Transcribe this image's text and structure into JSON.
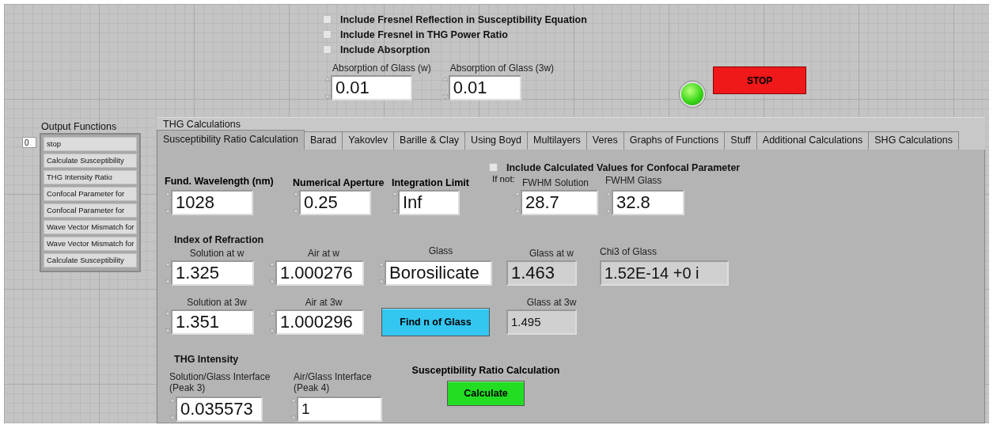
{
  "top_options": [
    {
      "label": "Include Fresnel Reflection in Susceptibility Equation",
      "checked": false
    },
    {
      "label": "Include Fresnel in THG Power Ratio",
      "checked": false
    },
    {
      "label": "Include Absorption",
      "checked": false
    }
  ],
  "absorption": [
    {
      "label": "Absorption of Glass (w)",
      "value": "0.01"
    },
    {
      "label": "Absorption of Glass (3w)",
      "value": "0.01"
    }
  ],
  "indicator_light": {
    "on": true
  },
  "stop_button": {
    "label": "STOP"
  },
  "output_functions": {
    "title": "Output Functions",
    "index": "0",
    "items": [
      "stop",
      "Calculate Susceptibility",
      "THG Intensity Ratio",
      "Confocal Parameter for",
      "Confocal Parameter for",
      "Wave Vector Mismatch for",
      "Wave Vector Mismatch for",
      "Calculate Susceptibility"
    ]
  },
  "tab_control": {
    "label": "THG Calculations",
    "tabs": [
      {
        "label": "Susceptibility Ratio Calculation",
        "selected": true
      },
      {
        "label": "Barad",
        "selected": false
      },
      {
        "label": "Yakovlev",
        "selected": false
      },
      {
        "label": "Barille & Clay",
        "selected": false
      },
      {
        "label": "Using Boyd",
        "selected": false
      },
      {
        "label": "Multilayers",
        "selected": false
      },
      {
        "label": "Veres",
        "selected": false
      },
      {
        "label": "Graphs of Functions",
        "selected": false
      },
      {
        "label": "Stuff",
        "selected": false
      },
      {
        "label": "Additional Calculations",
        "selected": false
      },
      {
        "label": "SHG Calculations",
        "selected": false
      }
    ],
    "confocal_option": {
      "label": "Include Calculated Values for Confocal Parameter",
      "checked": false,
      "note": "If not:"
    },
    "sections": [
      {
        "rows": [
          [
            {
              "kind": "numeric",
              "label": "Fund. Wavelength (nm)",
              "bold_label": true,
              "value": "1028"
            },
            {
              "kind": "numeric",
              "label": "Numerical Aperture",
              "bold_label": true,
              "value": "0.25"
            },
            {
              "kind": "numeric",
              "label": "Integration Limit",
              "bold_label": true,
              "value": "Inf"
            },
            {
              "kind": "numeric",
              "label": "FWHM Solution",
              "bold_label": false,
              "value": "28.7"
            },
            {
              "kind": "numeric",
              "label": "FWHM Glass",
              "bold_label": false,
              "value": "32.8"
            }
          ]
        ]
      },
      {
        "heading": "Index of Refraction",
        "rows": [
          [
            {
              "kind": "numeric",
              "label": "Solution at w",
              "bold_label": false,
              "value": "1.325"
            },
            {
              "kind": "numeric",
              "label": "Air at w",
              "bold_label": false,
              "value": "1.000276"
            },
            {
              "kind": "numeric",
              "label": "Glass",
              "bold_label": false,
              "value": "Borosilicate"
            },
            {
              "kind": "indicator",
              "label": "Glass at w",
              "bold_label": false,
              "value": "1.463"
            },
            {
              "kind": "indicator",
              "label": "Chi3 of Glass",
              "bold_label": false,
              "value": "1.52E-14 +0 i"
            }
          ],
          [
            {
              "kind": "numeric",
              "label": "Solution at 3w",
              "bold_label": false,
              "value": "1.351"
            },
            {
              "kind": "numeric",
              "label": "Air at 3w",
              "bold_label": false,
              "value": "1.000296"
            },
            {
              "kind": "button",
              "label": "Find n of Glass",
              "color": "#33c6f0"
            },
            {
              "kind": "indicator",
              "label": "Glass at 3w",
              "bold_label": false,
              "value": "1.495"
            }
          ]
        ]
      },
      {
        "heading": "THG Intensity",
        "rows": [
          [
            {
              "kind": "numeric",
              "label": "Solution/Glass Interface (Peak 3)",
              "bold_label": false,
              "value": "0.035573"
            },
            {
              "kind": "numeric",
              "label": "Air/Glass Interface (Peak 4)",
              "bold_label": false,
              "value": "1"
            },
            {
              "kind": "button",
              "title": "Susceptibility Ratio Calculation",
              "label": "Calculate",
              "color": "#22dd22"
            }
          ]
        ]
      }
    ]
  }
}
